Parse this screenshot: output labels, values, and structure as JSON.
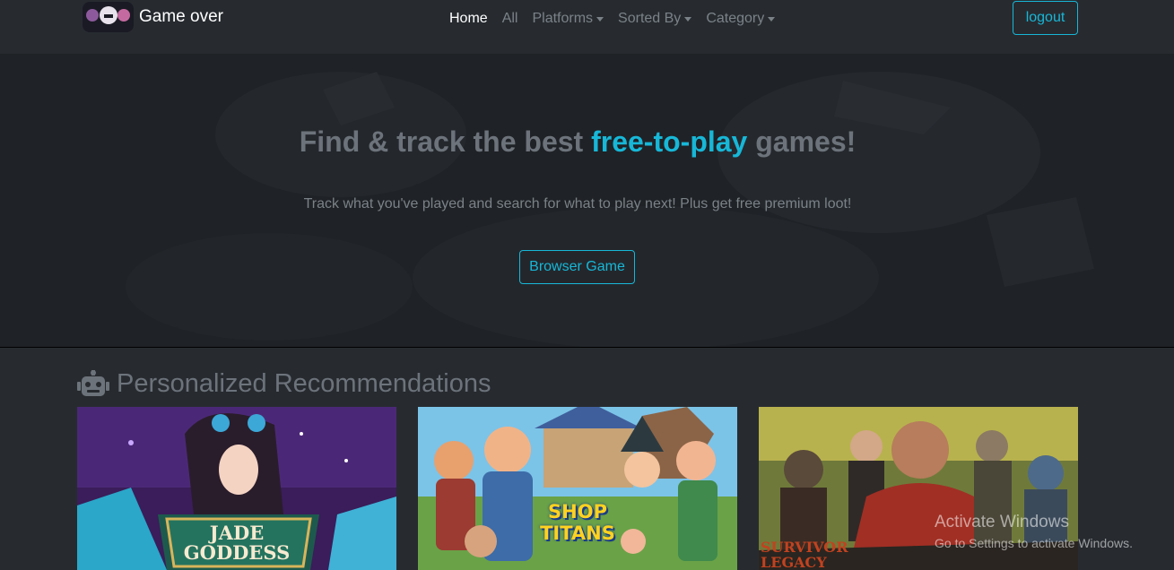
{
  "brand": {
    "name": "Game over",
    "logo": "controller-face-logo"
  },
  "nav": {
    "home": "Home",
    "all": "All",
    "platforms": "Platforms",
    "sorted_by": "Sorted By",
    "category": "Category",
    "logout": "logout"
  },
  "hero": {
    "title_prefix": "Find & track the best ",
    "title_accent": "free-to-play",
    "title_suffix": " games!",
    "subtitle": "Track what you've played and search for what to play next! Plus get free premium loot!",
    "button": "Browser Game"
  },
  "recommendations": {
    "icon": "robot-icon",
    "title": "Personalized Recommendations",
    "cards": [
      {
        "title": "JADE GODDESS"
      },
      {
        "title": "SHOP TITANS"
      },
      {
        "title": "SURVIVOR LEGACY"
      }
    ]
  },
  "watermark": {
    "title": "Activate Windows",
    "subtitle": "Go to Settings to activate Windows."
  },
  "colors": {
    "accent": "#17b7d7",
    "background": "#272b30",
    "muted": "#7a8288"
  }
}
